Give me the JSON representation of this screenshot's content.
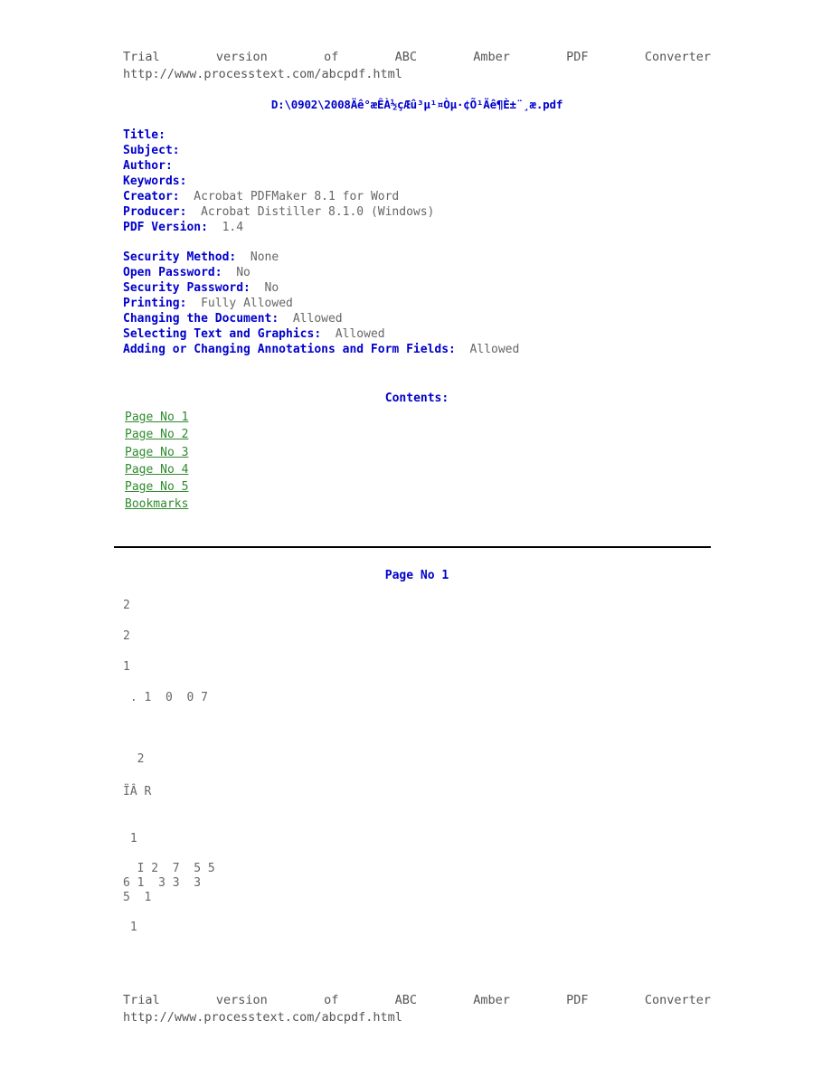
{
  "trial_header": {
    "words": [
      "Trial",
      "version",
      "of",
      "ABC",
      "Amber",
      "PDF",
      "Converter"
    ],
    "url": "http://www.processtext.com/abcpdf.html"
  },
  "trial_footer": {
    "words": [
      "Trial",
      "version",
      "of",
      "ABC",
      "Amber",
      "PDF",
      "Converter"
    ],
    "url": "http://www.processtext.com/abcpdf.html"
  },
  "document": {
    "title_path": "D:\\0902\\2008Äê°æÊÀ½çÆû³µ¹¤Òµ·¢Õ¹Äê¶È±¨¸æ.pdf"
  },
  "metadata_basic": [
    {
      "label": "Title:",
      "value": ""
    },
    {
      "label": "Subject:",
      "value": ""
    },
    {
      "label": "Author:",
      "value": ""
    },
    {
      "label": "Keywords:",
      "value": ""
    },
    {
      "label": "Creator:",
      "value": "  Acrobat PDFMaker 8.1 for Word"
    },
    {
      "label": "Producer:",
      "value": "  Acrobat Distiller 8.1.0 (Windows)"
    },
    {
      "label": "PDF Version:",
      "value": "  1.4"
    }
  ],
  "metadata_security": [
    {
      "label": "Security Method:",
      "value": "  None"
    },
    {
      "label": "Open Password:",
      "value": "  No"
    },
    {
      "label": "Security Password:",
      "value": "  No"
    },
    {
      "label": "Printing:",
      "value": "  Fully Allowed"
    },
    {
      "label": "Changing the Document:",
      "value": "  Allowed"
    },
    {
      "label": "Selecting Text and Graphics:",
      "value": "  Allowed"
    },
    {
      "label": "Adding or Changing Annotations and Form Fields:",
      "value": "  Allowed"
    }
  ],
  "contents": {
    "heading": "Contents:",
    "links": [
      "Page No 1",
      "Page No 2",
      "Page No 3",
      "Page No 4",
      "Page No 5",
      "Bookmarks"
    ]
  },
  "page_section": {
    "heading": "Page No 1",
    "lines": [
      {
        "text": "2",
        "gap": 0
      },
      {
        "text": "2",
        "gap": 18
      },
      {
        "text": "1",
        "gap": 18
      },
      {
        "text": " . 1  0  0 7",
        "gap": 18
      },
      {
        "text": "  2",
        "gap": 52
      },
      {
        "text": "ÏÂ R",
        "gap": 20
      },
      {
        "text": " 1",
        "gap": 36
      },
      {
        "text": "  I 2  7  5 5",
        "gap": 17
      },
      {
        "text": "6 1  3 3  3",
        "gap": 0
      },
      {
        "text": "5  1",
        "gap": 0
      },
      {
        "text": " 1",
        "gap": 17
      }
    ]
  },
  "colors": {
    "label_blue": "#0000cc",
    "body_gray": "#666666",
    "link_green": "#2e8b2e",
    "rule_black": "#000000"
  }
}
